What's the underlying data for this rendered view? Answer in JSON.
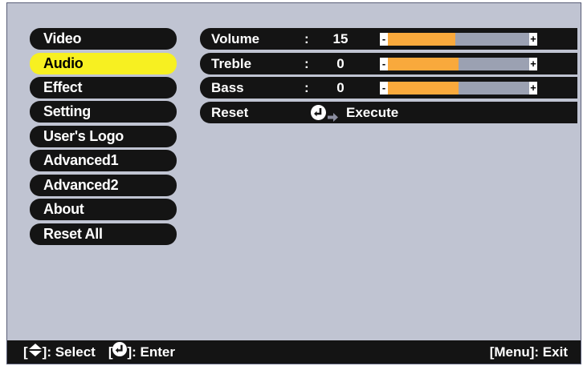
{
  "menu": {
    "items": [
      {
        "label": "Video",
        "selected": false
      },
      {
        "label": "Audio",
        "selected": true
      },
      {
        "label": "Effect",
        "selected": false
      },
      {
        "label": "Setting",
        "selected": false
      },
      {
        "label": "User's Logo",
        "selected": false
      },
      {
        "label": "Advanced1",
        "selected": false
      },
      {
        "label": "Advanced2",
        "selected": false
      },
      {
        "label": "About",
        "selected": false
      },
      {
        "label": "Reset All",
        "selected": false
      }
    ]
  },
  "settings": {
    "volume": {
      "label": "Volume",
      "colon": ":",
      "value": "15",
      "level": 0.48
    },
    "treble": {
      "label": "Treble",
      "colon": ":",
      "value": "0",
      "level": 0.5
    },
    "bass": {
      "label": "Bass",
      "colon": ":",
      "value": "0",
      "level": 0.5
    },
    "reset": {
      "label": "Reset",
      "action": "Execute"
    }
  },
  "bar_symbols": {
    "minus": "-",
    "plus": "+"
  },
  "footer": {
    "select_bracket_open": "[",
    "select_text": "]: Select",
    "enter_bracket_open": "[",
    "enter_text": "]: Enter",
    "exit_text": "[Menu]: Exit"
  },
  "colors": {
    "background": "#c0c4d2",
    "item_bg": "#141414",
    "selected": "#f7f021",
    "bar_fill": "#f9a93c",
    "bar_track": "#9ba1b2"
  }
}
